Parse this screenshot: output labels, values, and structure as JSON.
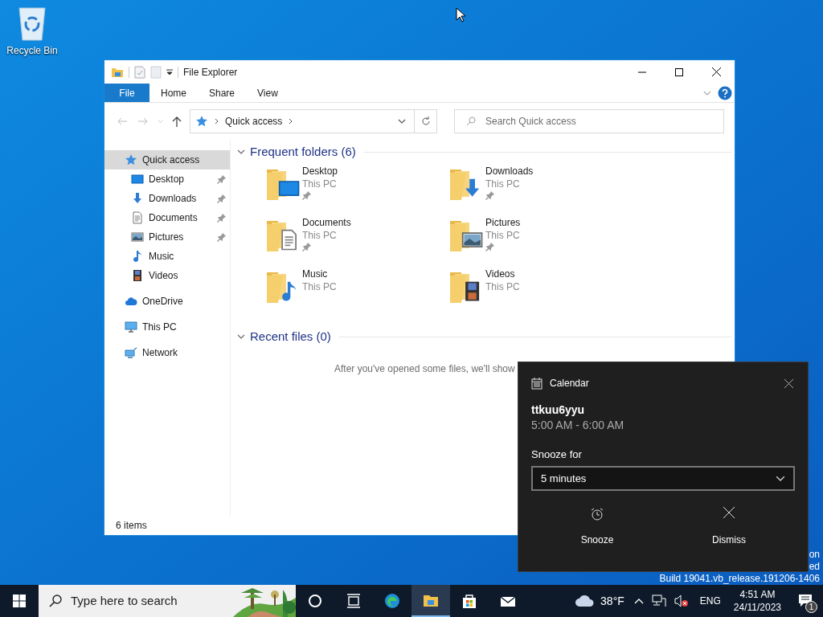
{
  "desktop_icons": [
    {
      "label": "Recycle Bin"
    }
  ],
  "explorer": {
    "title": "File Explorer",
    "file_button": "File",
    "ribbon_tabs": [
      "Home",
      "Share",
      "View"
    ],
    "address": {
      "path": "Quick access"
    },
    "search": {
      "placeholder": "Search Quick access"
    },
    "nav": [
      {
        "label": "Quick access",
        "kind": "quick",
        "selected": true,
        "children": [
          {
            "label": "Desktop",
            "kind": "desktop",
            "selected": false,
            "pinned": true
          },
          {
            "label": "Downloads",
            "kind": "downloads",
            "selected": false,
            "pinned": true
          },
          {
            "label": "Documents",
            "kind": "documents",
            "selected": false,
            "pinned": true
          },
          {
            "label": "Pictures",
            "kind": "pictures",
            "selected": false,
            "pinned": true
          },
          {
            "label": "Music",
            "kind": "music",
            "selected": false,
            "pinned": false
          },
          {
            "label": "Videos",
            "kind": "videos",
            "selected": false,
            "pinned": false
          }
        ]
      },
      {
        "label": "OneDrive",
        "kind": "onedrive",
        "selected": false
      },
      {
        "label": "This PC",
        "kind": "pc",
        "selected": false
      },
      {
        "label": "Network",
        "kind": "network",
        "selected": false
      }
    ],
    "sections": [
      {
        "title": "Frequent folders (6)",
        "items": [
          {
            "name": "Desktop",
            "location": "This PC",
            "kind": "desktop",
            "pinned": true
          },
          {
            "name": "Downloads",
            "location": "This PC",
            "kind": "downloads",
            "pinned": true
          },
          {
            "name": "Documents",
            "location": "This PC",
            "kind": "documents",
            "pinned": true
          },
          {
            "name": "Pictures",
            "location": "This PC",
            "kind": "pictures",
            "pinned": true
          },
          {
            "name": "Music",
            "location": "This PC",
            "kind": "music",
            "pinned": false
          },
          {
            "name": "Videos",
            "location": "This PC",
            "kind": "videos",
            "pinned": false
          }
        ]
      },
      {
        "title": "Recent files (0)",
        "message": "After you've opened some files, we'll show"
      }
    ],
    "status_bar": "6 items"
  },
  "notification": {
    "app": "Calendar",
    "title": "ttkuu6yyu",
    "time": "5:00 AM - 6:00 AM",
    "snooze_label": "Snooze for",
    "snooze_value": "5 minutes",
    "actions": [
      {
        "label": "Snooze",
        "kind": "snooze"
      },
      {
        "label": "Dismiss",
        "kind": "dismiss"
      }
    ]
  },
  "watermark_lines": [
    "on",
    "ed",
    "Build 19041.vb_release.191206-1406"
  ],
  "taskbar": {
    "search_placeholder": "Type here to search",
    "apps": [
      {
        "kind": "cortana",
        "active": false
      },
      {
        "kind": "taskview",
        "active": false
      },
      {
        "kind": "edge",
        "active": false
      },
      {
        "kind": "explorer",
        "active": true
      },
      {
        "kind": "store",
        "active": false
      },
      {
        "kind": "mail",
        "active": false
      }
    ],
    "weather": "38°F",
    "language": "ENG",
    "time": "4:51 AM",
    "date": "24/11/2023",
    "notification_count": "1"
  }
}
